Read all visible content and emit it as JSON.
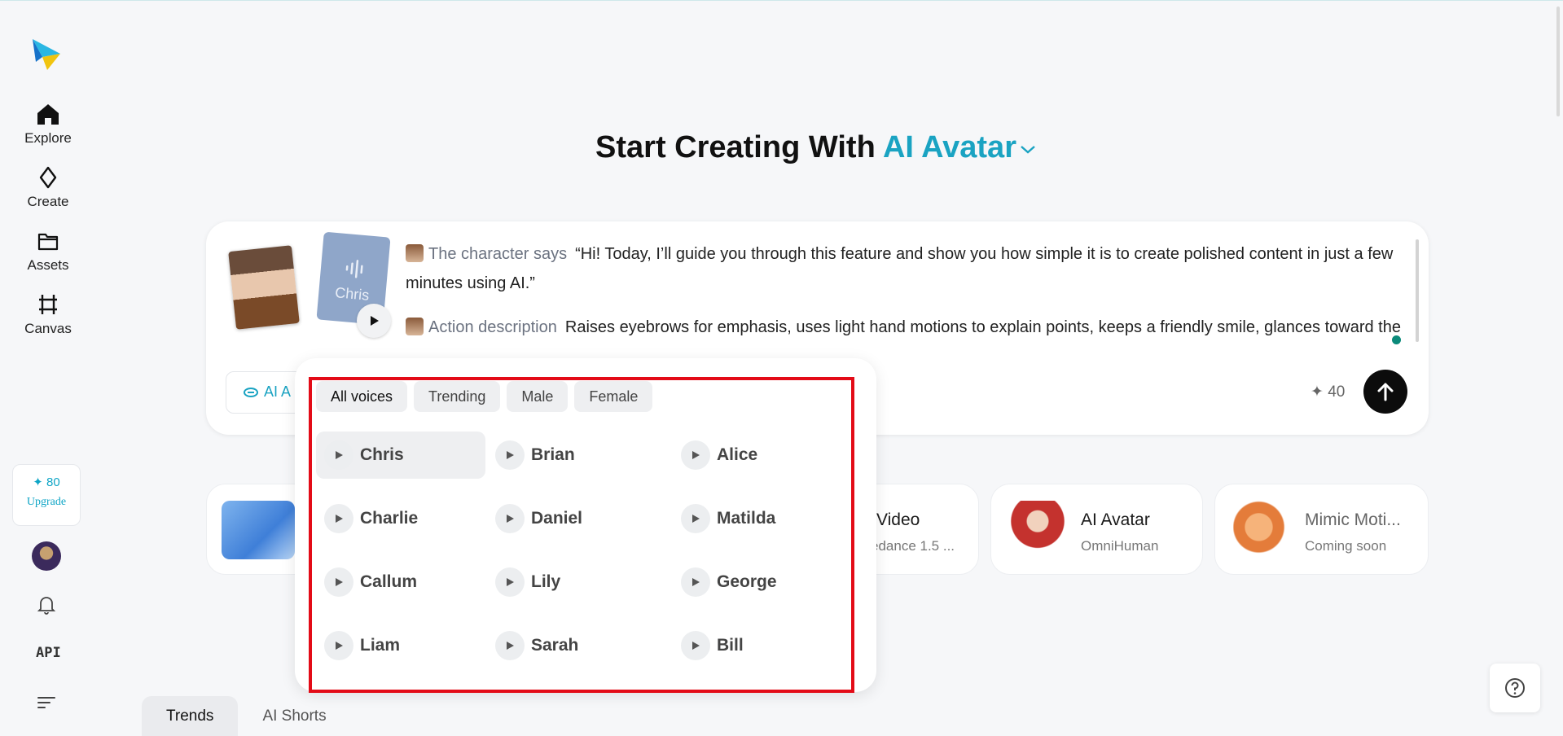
{
  "sidebar": {
    "items": [
      {
        "label": "Explore",
        "icon": "home-icon"
      },
      {
        "label": "Create",
        "icon": "sparkle-icon"
      },
      {
        "label": "Assets",
        "icon": "folder-icon"
      },
      {
        "label": "Canvas",
        "icon": "crop-icon"
      }
    ],
    "upgrade": {
      "credits": "✦ 80",
      "label": "Upgrade"
    },
    "api_label": "API"
  },
  "headline": {
    "prefix": "Start Creating With",
    "mode": "AI Avatar"
  },
  "prompt": {
    "voice_card_name": "Chris",
    "character_tag": "The character says",
    "character_text": "“Hi! Today, I’ll guide you through this feature and show you how simple it is to create polished content in just a few minutes using AI.”",
    "action_tag": "Action description",
    "action_text": "Raises eyebrows for emphasis, uses light hand motions to explain points, keeps a friendly smile, glances toward the audience, and ends with a small, confident nod.",
    "mode_pill_label": "AI A",
    "cost": "✦ 40"
  },
  "tools": [
    {
      "title": "Video",
      "subtitle": "edance 1.5 ..."
    },
    {
      "title": "AI Avatar",
      "subtitle": "OmniHuman"
    },
    {
      "title": "Mimic Moti...",
      "subtitle": "Coming soon"
    }
  ],
  "voice_popup": {
    "filters": [
      "All voices",
      "Trending",
      "Male",
      "Female"
    ],
    "active_filter": "All voices",
    "voices": [
      "Chris",
      "Brian",
      "Alice",
      "Charlie",
      "Daniel",
      "Matilda",
      "Callum",
      "Lily",
      "George",
      "Liam",
      "Sarah",
      "Bill"
    ],
    "selected_voice": "Chris"
  },
  "bottom_tabs": [
    "Trends",
    "AI Shorts"
  ],
  "colors": {
    "accent": "#1aa3c2",
    "highlight_box": "#e30b17"
  }
}
